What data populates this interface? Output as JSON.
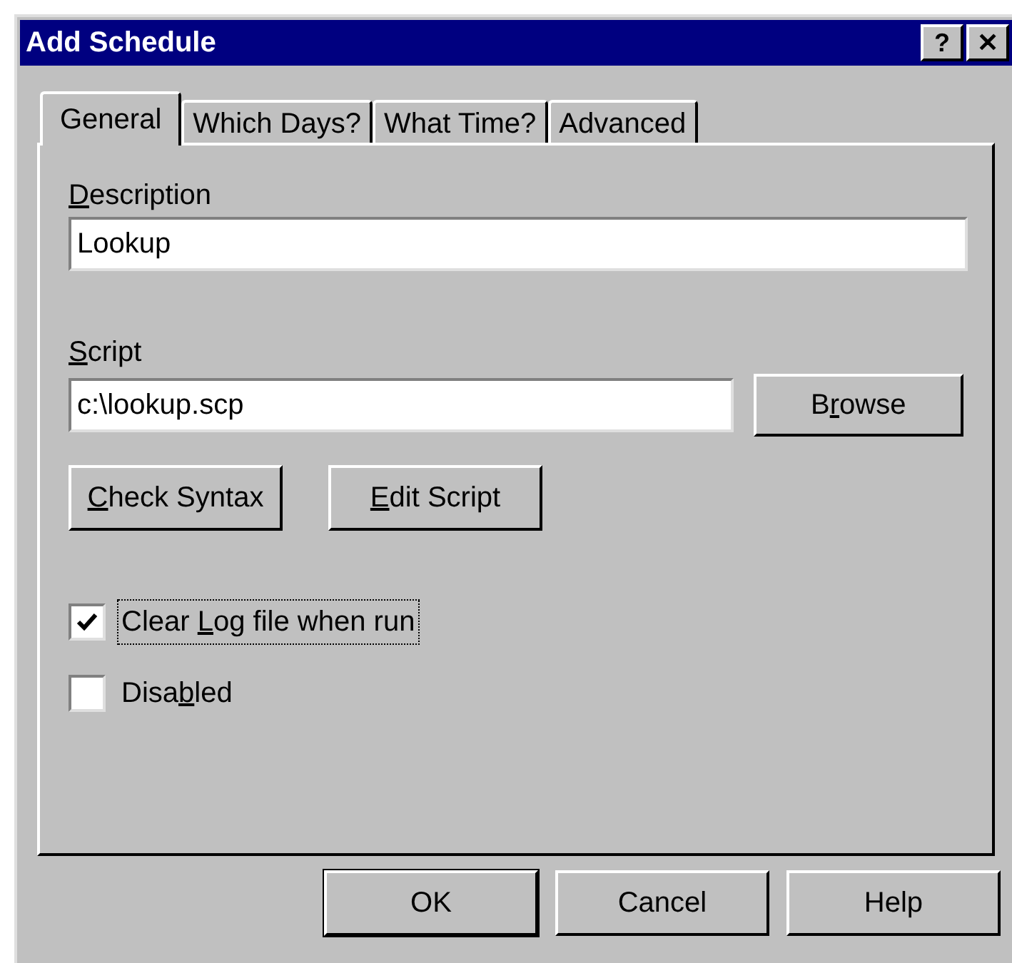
{
  "window": {
    "title": "Add Schedule",
    "title_buttons": [
      "?",
      "✕"
    ]
  },
  "tabs": [
    {
      "label": "General",
      "selected": true
    },
    {
      "label": "Which Days?",
      "selected": false
    },
    {
      "label": "What Time?",
      "selected": false
    },
    {
      "label": "Advanced",
      "selected": false
    }
  ],
  "description": {
    "label": {
      "key": "D",
      "after": "escription"
    },
    "value": "Lookup"
  },
  "script": {
    "label": {
      "key": "S",
      "after": "cript"
    },
    "value": "c:\\lookup.scp",
    "browse": {
      "before": "B",
      "key": "r",
      "after": "owse"
    }
  },
  "script_buttons": [
    {
      "key": "C",
      "after": "heck Syntax"
    },
    {
      "key": "E",
      "after": "dit Script"
    }
  ],
  "options": [
    {
      "label": {
        "before": "Clear ",
        "key": "L",
        "after": "og file when run"
      },
      "checked": true,
      "focused": true
    },
    {
      "label": {
        "before": "Disa",
        "key": "b",
        "after": "led"
      },
      "checked": false,
      "focused": false
    }
  ],
  "buttons": [
    {
      "label": "OK",
      "default": true
    },
    {
      "label": "Cancel",
      "default": false
    },
    {
      "label": "Help",
      "default": false
    }
  ]
}
